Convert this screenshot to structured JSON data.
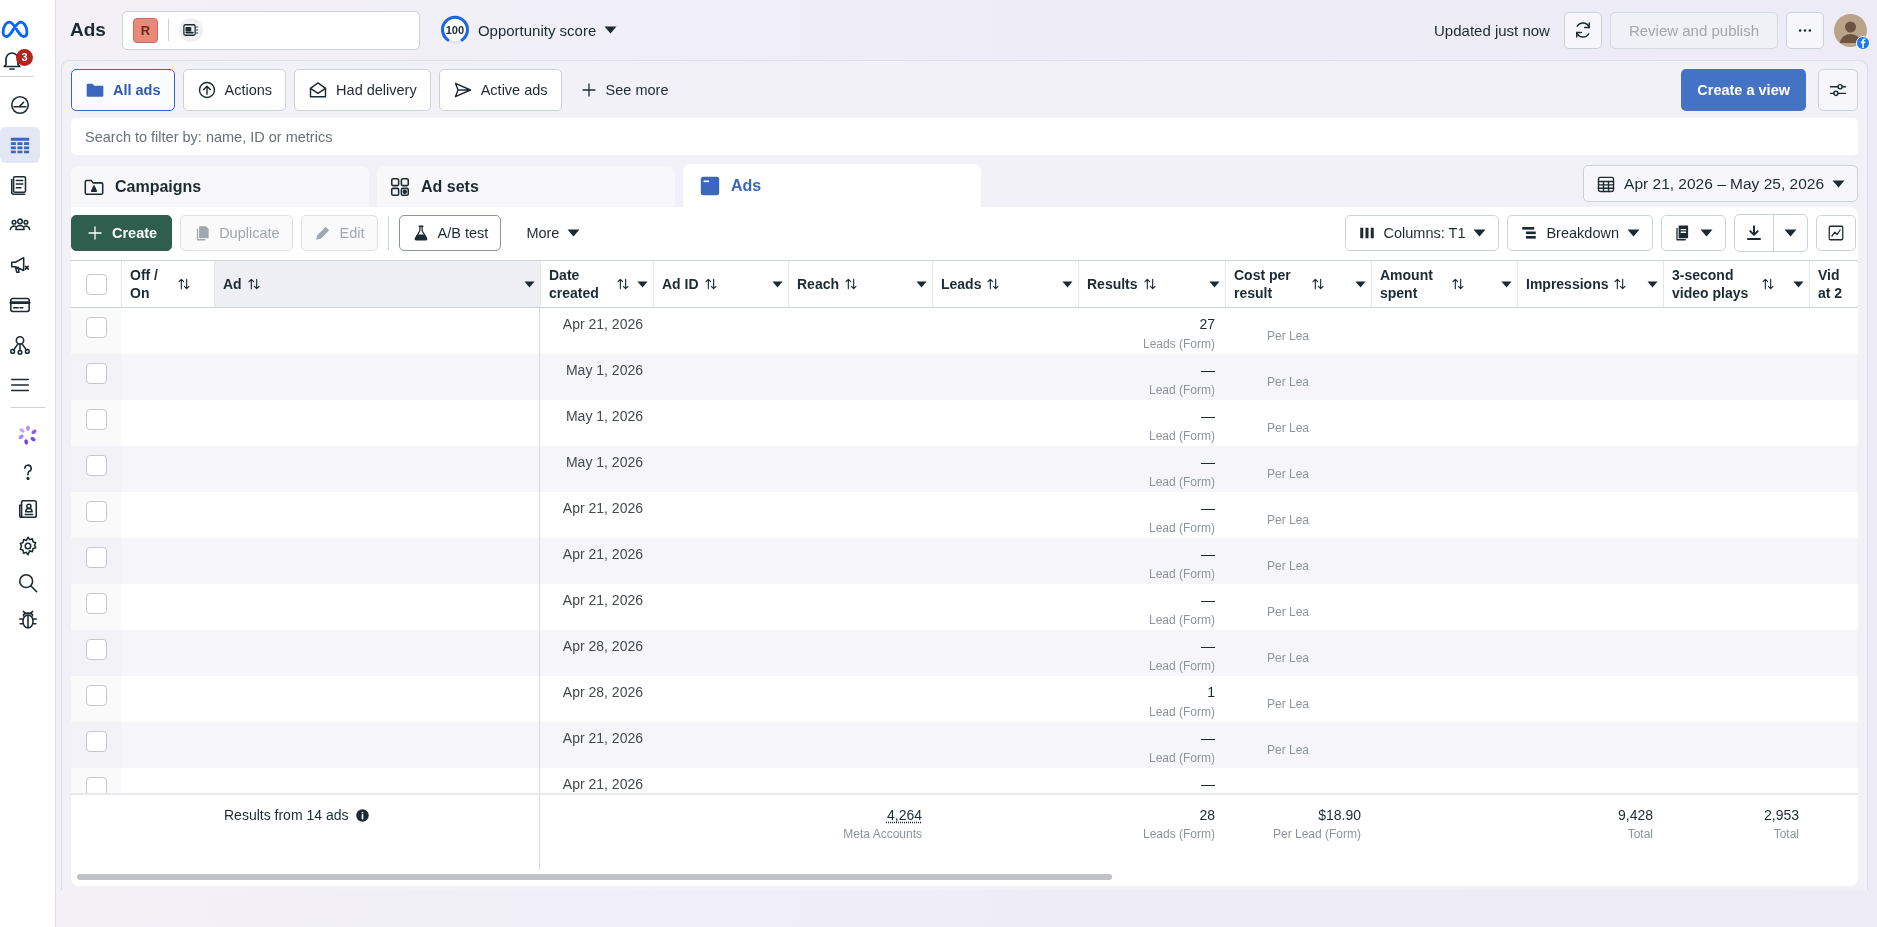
{
  "sidebar": {
    "notification_count": "3",
    "nav": [
      {
        "selected": false
      },
      {
        "selected": true
      },
      {
        "selected": false
      },
      {
        "selected": false
      },
      {
        "selected": false
      },
      {
        "selected": false
      },
      {
        "selected": false
      },
      {
        "selected": false
      }
    ]
  },
  "header": {
    "title": "Ads",
    "account_initial": "R",
    "opportunity_score": "100",
    "opportunity_label": "Opportunity score",
    "status": "Updated just now",
    "publish_button": {
      "label": "Review and publish",
      "disabled": true
    }
  },
  "views": {
    "chips": [
      {
        "label": "All ads",
        "selected": true
      },
      {
        "label": "Actions",
        "selected": false
      },
      {
        "label": "Had delivery",
        "selected": false
      },
      {
        "label": "Active ads",
        "selected": false
      }
    ],
    "see_more": "See more",
    "create_view": "Create a view"
  },
  "search": {
    "placeholder": "Search to filter by: name, ID or metrics"
  },
  "level_tabs": [
    {
      "label": "Campaigns",
      "selected": false
    },
    {
      "label": "Ad sets",
      "selected": false
    },
    {
      "label": "Ads",
      "selected": true
    }
  ],
  "date_range": "Apr 21, 2026 – May 25, 2026",
  "toolbar": {
    "actions": [
      {
        "label": "Create",
        "kind": "primary",
        "disabled": false
      },
      {
        "label": "Duplicate",
        "kind": "duplicate",
        "disabled": true
      },
      {
        "label": "Edit",
        "kind": "edit",
        "disabled": true
      },
      {
        "label": "A/B test",
        "kind": "test",
        "disabled": false
      },
      {
        "label": "More",
        "kind": "menu",
        "disabled": false
      }
    ],
    "columns_button": "Columns: T1",
    "breakdown_button": "Breakdown"
  },
  "table": {
    "all_selected": false,
    "columns": [
      {
        "label": "Off / On",
        "sortable": true,
        "menu": false,
        "highlighted": false
      },
      {
        "label": "Ad",
        "sortable": true,
        "menu": true,
        "highlighted": true
      },
      {
        "label": "Date created",
        "sortable": true,
        "menu": true,
        "highlighted": false
      },
      {
        "label": "Ad ID",
        "sortable": true,
        "menu": true,
        "highlighted": false
      },
      {
        "label": "Reach",
        "sortable": true,
        "menu": true,
        "highlighted": false
      },
      {
        "label": "Leads",
        "sortable": true,
        "menu": true,
        "highlighted": false
      },
      {
        "label": "Results",
        "sortable": true,
        "menu": true,
        "highlighted": false
      },
      {
        "label": "Cost per result",
        "sortable": true,
        "menu": true,
        "highlighted": false
      },
      {
        "label": "Amount spent",
        "sortable": true,
        "menu": true,
        "highlighted": false
      },
      {
        "label": "Impressions",
        "sortable": true,
        "menu": true,
        "highlighted": false
      },
      {
        "label": "3-second video plays",
        "sortable": true,
        "menu": true,
        "highlighted": false
      },
      {
        "label": "Vid at 2",
        "highlighted": false
      }
    ],
    "rows": [
      {
        "checked": false,
        "date_created": "Apr 21, 2026",
        "results": "27",
        "result_type": "Leads (Form)",
        "cost_note": "Per Lea"
      },
      {
        "checked": false,
        "date_created": "May 1, 2026",
        "results": "—",
        "result_type": "Lead (Form)",
        "cost_note": "Per Lea"
      },
      {
        "checked": false,
        "date_created": "May 1, 2026",
        "results": "—",
        "result_type": "Lead (Form)",
        "cost_note": "Per Lea"
      },
      {
        "checked": false,
        "date_created": "May 1, 2026",
        "results": "—",
        "result_type": "Lead (Form)",
        "cost_note": "Per Lea"
      },
      {
        "checked": false,
        "date_created": "Apr 21, 2026",
        "results": "—",
        "result_type": "Lead (Form)",
        "cost_note": "Per Lea"
      },
      {
        "checked": false,
        "date_created": "Apr 21, 2026",
        "results": "—",
        "result_type": "Lead (Form)",
        "cost_note": "Per Lea"
      },
      {
        "checked": false,
        "date_created": "Apr 21, 2026",
        "results": "—",
        "result_type": "Lead (Form)",
        "cost_note": "Per Lea"
      },
      {
        "checked": false,
        "date_created": "Apr 28, 2026",
        "results": "—",
        "result_type": "Lead (Form)",
        "cost_note": "Per Lea"
      },
      {
        "checked": false,
        "date_created": "Apr 28, 2026",
        "results": "1",
        "result_type": "Lead (Form)",
        "cost_note": "Per Lea"
      },
      {
        "checked": false,
        "date_created": "Apr 21, 2026",
        "results": "—",
        "result_type": "Lead (Form)",
        "cost_note": "Per Lea"
      },
      {
        "checked": false,
        "date_created": "Apr 21, 2026",
        "results": "—"
      }
    ],
    "summary": {
      "label": "Results from 14 ads",
      "reach": {
        "value": "4,264",
        "note": "Meta Accounts"
      },
      "results": {
        "value": "28",
        "note": "Leads (Form)"
      },
      "cost_per_result": {
        "value": "$18.90",
        "note": "Per Lead (Form)"
      },
      "impressions": {
        "value": "9,428",
        "note": "Total"
      },
      "video_plays": {
        "value": "2,953",
        "note": "Total"
      }
    }
  }
}
